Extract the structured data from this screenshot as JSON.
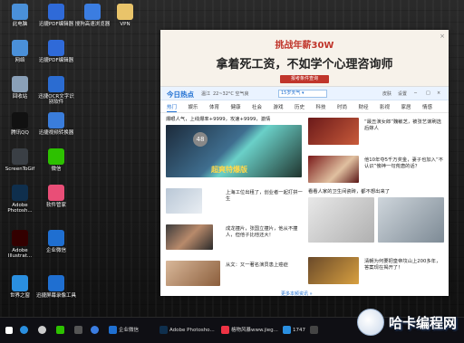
{
  "desktop": {
    "icons": [
      {
        "label": "此电脑",
        "icon": "computer-icon",
        "color": "#4a90d9"
      },
      {
        "label": "迅捷PDF编辑器",
        "icon": "pdf-editor-icon",
        "color": "#2f6ad8"
      },
      {
        "label": "搜狗高速浏览器",
        "icon": "sogou-browser-icon",
        "color": "#3b7de1"
      },
      {
        "label": "VPN",
        "icon": "folder-icon",
        "color": "#e9c46a"
      },
      {
        "label": "网络",
        "icon": "network-icon",
        "color": "#4a90d9"
      },
      {
        "label": "迅捷PDF编辑器",
        "icon": "pdf-editor-icon",
        "color": "#2f6ad8"
      },
      {
        "label": "回收站",
        "icon": "recycle-bin-icon",
        "color": "#8aa0b8"
      },
      {
        "label": "迅捷OCR文字识别软件",
        "icon": "ocr-icon",
        "color": "#2b6cd1"
      },
      {
        "label": "腾讯QQ",
        "icon": "qq-icon",
        "color": "#111111"
      },
      {
        "label": "迅捷视频转换器",
        "icon": "video-converter-icon",
        "color": "#3a7ddb"
      },
      {
        "label": "ScreenToGif",
        "icon": "screentogif-icon",
        "color": "#3a3f45"
      },
      {
        "label": "微信",
        "icon": "wechat-icon",
        "color": "#2dc100"
      },
      {
        "label": "Adobe Photosh...",
        "icon": "photoshop-icon",
        "color": "#0f2f4d"
      },
      {
        "label": "软件管家",
        "icon": "software-manager-icon",
        "color": "#e94e77"
      },
      {
        "label": "Adobe Illustrat...",
        "icon": "illustrator-icon",
        "color": "#330000"
      },
      {
        "label": "企业微信",
        "icon": "wecom-icon",
        "color": "#1f6fd1"
      },
      {
        "label": "世界之窗",
        "icon": "theworld-browser-icon",
        "color": "#2a8fe0"
      },
      {
        "label": "迅捷屏幕录像工具",
        "icon": "screen-recorder-icon",
        "color": "#1f6fd1"
      }
    ]
  },
  "popup": {
    "ad_line1": "挑战年薪30W",
    "ad_line2": "拿着死工资，不如学个心理咨询师",
    "ad_button": "报考条件查询",
    "close": "×",
    "app": {
      "logo": "今日热点",
      "location": "温江",
      "weather": "22~32°C 空气良",
      "search_placeholder": "15岁天气 ▾",
      "toolbar": [
        "皮肤",
        "设置",
        "─",
        "□",
        "×"
      ],
      "tabs": [
        "热门",
        "娱乐",
        "体育",
        "健康",
        "社会",
        "游戏",
        "历史",
        "科技",
        "时尚",
        "财经",
        "影视",
        "家居",
        "情感"
      ],
      "news": [
        "爆眼人气，上线爆率+9999，攻速+9999，激情",
        "“最丑演女郎”魏敏芝，被张艺谋刷选后嫁人",
        "上海工位出租了，创业者一起打拼一生",
        "他10年夺5千万奖金，妻子也加入“不认识”傍神一句荒唐的话？",
        "看看人家的卫生间瓷砖，都不想出来了",
        "成龙撞片，张国立撞片，他从不撞人，但他子比他还大！",
        "从文：又一著名演员患上癌症",
        "清朝为何要把皇帝坟山上200多年，答案现在揭开了！",
        "更多本频资讯 »"
      ],
      "thumb_badge": "48",
      "thumb_caption": "超爽特爆版"
    }
  },
  "taskbar": {
    "items": [
      "企业微信",
      "Adobe Photosho...",
      "格物风暴www.jieg...",
      "1747",
      "宇哈编程网"
    ]
  },
  "watermark": {
    "text": "哈卡编程网"
  }
}
